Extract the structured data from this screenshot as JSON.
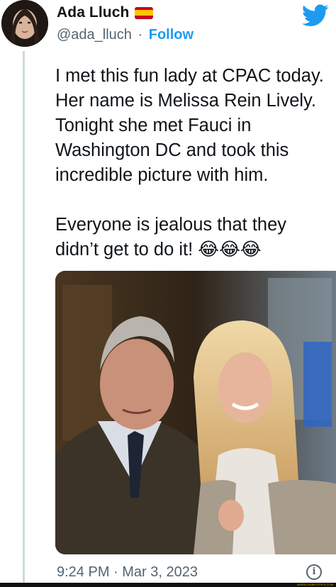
{
  "author": {
    "display_name": "Ada Lluch",
    "handle": "@ada_lluch",
    "separator": "·",
    "follow_label": "Follow",
    "flag_colors": [
      "#c60b1e",
      "#ffc400",
      "#c60b1e"
    ]
  },
  "tweet": {
    "text": "I met this fun lady at CPAC today. Her name is Melissa Rein Lively. Tonight she met Fauci in Washington DC and took this incredible picture with him.\n\nEveryone is jealous that they didn’t get to do it! 😂😂😂",
    "timestamp": "9:24 PM · Mar 3, 2023"
  },
  "icons": {
    "brand": "twitter-bird-icon",
    "info": "info-icon"
  },
  "colors": {
    "accent": "#1d9bf0",
    "secondary_text": "#536471",
    "primary_text": "#0f1419"
  },
  "watermark": "AMERICASBESTPICS.COM"
}
